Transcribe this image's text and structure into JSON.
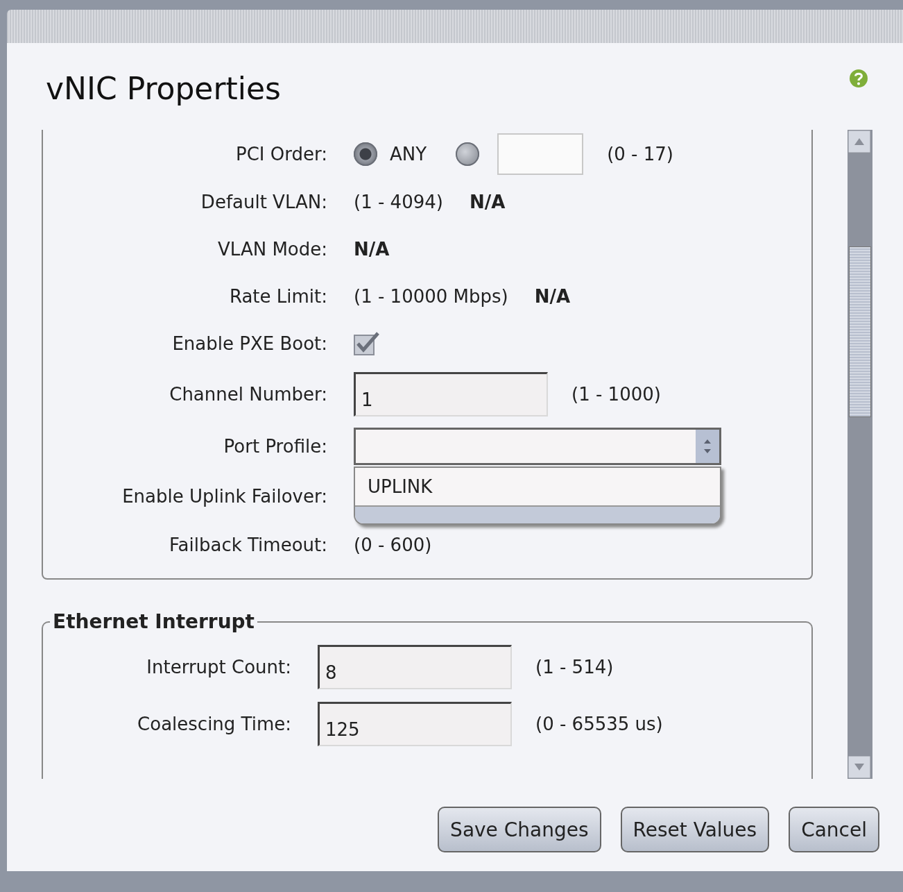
{
  "window": {
    "title": "vNIC Properties"
  },
  "general": {
    "fields": [
      {
        "kind": "radio",
        "label": "PCI Order:",
        "options": [
          {
            "label": "ANY",
            "selected": true
          },
          {
            "kind": "custom",
            "selected": false
          }
        ],
        "hint": "(0 - 17)"
      },
      {
        "kind": "info",
        "label": "Default VLAN:",
        "hint": "(1 - 4094)",
        "value": "N/A"
      },
      {
        "kind": "info",
        "label": "VLAN Mode:",
        "value": "N/A"
      },
      {
        "kind": "info",
        "label": "Rate Limit:",
        "hint": "(1 - 10000 Mbps)",
        "value": "N/A"
      },
      {
        "kind": "checkbox",
        "label": "Enable PXE Boot:",
        "checked": true
      },
      {
        "kind": "input",
        "label": "Channel Number:",
        "value": "1",
        "hint": "(1 - 1000)"
      },
      {
        "kind": "select",
        "label": "Port Profile:",
        "expanded": true,
        "options": [
          "UPLINK"
        ]
      },
      {
        "kind": "blank",
        "label": "Enable Uplink Failover:"
      },
      {
        "kind": "info",
        "label": "Failback Timeout:",
        "hint": "(0 - 600)"
      }
    ]
  },
  "ethernet_interrupt": {
    "title": "Ethernet Interrupt",
    "fields": [
      {
        "kind": "input",
        "label": "Interrupt Count:",
        "value": "8",
        "hint": "(1 - 514)"
      },
      {
        "kind": "input",
        "label": "Coalescing Time:",
        "value": "125",
        "hint": "(0 - 65535 us)"
      }
    ]
  },
  "buttons": [
    "Save Changes",
    "Reset Values",
    "Cancel"
  ]
}
